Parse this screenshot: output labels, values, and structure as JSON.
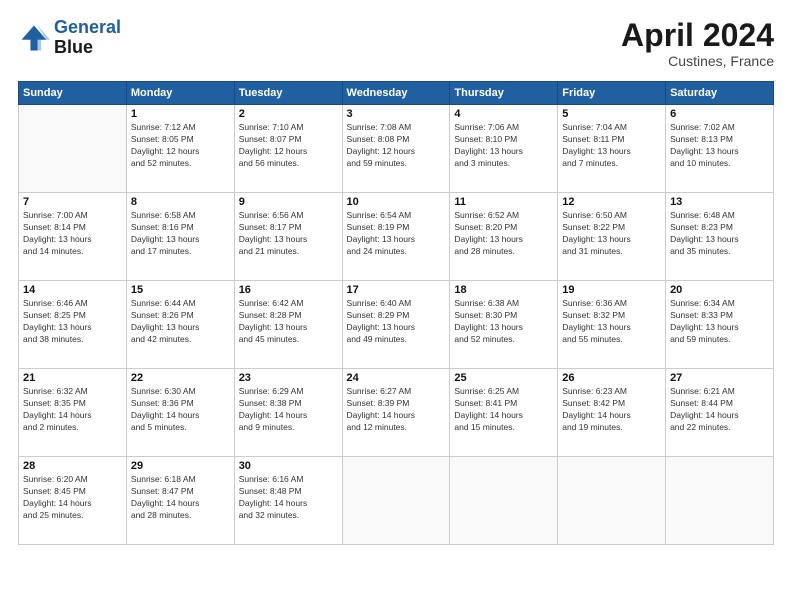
{
  "header": {
    "logo_line1": "General",
    "logo_line2": "Blue",
    "month_year": "April 2024",
    "location": "Custines, France"
  },
  "weekdays": [
    "Sunday",
    "Monday",
    "Tuesday",
    "Wednesday",
    "Thursday",
    "Friday",
    "Saturday"
  ],
  "weeks": [
    [
      {
        "day": "",
        "info": ""
      },
      {
        "day": "1",
        "info": "Sunrise: 7:12 AM\nSunset: 8:05 PM\nDaylight: 12 hours\nand 52 minutes."
      },
      {
        "day": "2",
        "info": "Sunrise: 7:10 AM\nSunset: 8:07 PM\nDaylight: 12 hours\nand 56 minutes."
      },
      {
        "day": "3",
        "info": "Sunrise: 7:08 AM\nSunset: 8:08 PM\nDaylight: 12 hours\nand 59 minutes."
      },
      {
        "day": "4",
        "info": "Sunrise: 7:06 AM\nSunset: 8:10 PM\nDaylight: 13 hours\nand 3 minutes."
      },
      {
        "day": "5",
        "info": "Sunrise: 7:04 AM\nSunset: 8:11 PM\nDaylight: 13 hours\nand 7 minutes."
      },
      {
        "day": "6",
        "info": "Sunrise: 7:02 AM\nSunset: 8:13 PM\nDaylight: 13 hours\nand 10 minutes."
      }
    ],
    [
      {
        "day": "7",
        "info": "Sunrise: 7:00 AM\nSunset: 8:14 PM\nDaylight: 13 hours\nand 14 minutes."
      },
      {
        "day": "8",
        "info": "Sunrise: 6:58 AM\nSunset: 8:16 PM\nDaylight: 13 hours\nand 17 minutes."
      },
      {
        "day": "9",
        "info": "Sunrise: 6:56 AM\nSunset: 8:17 PM\nDaylight: 13 hours\nand 21 minutes."
      },
      {
        "day": "10",
        "info": "Sunrise: 6:54 AM\nSunset: 8:19 PM\nDaylight: 13 hours\nand 24 minutes."
      },
      {
        "day": "11",
        "info": "Sunrise: 6:52 AM\nSunset: 8:20 PM\nDaylight: 13 hours\nand 28 minutes."
      },
      {
        "day": "12",
        "info": "Sunrise: 6:50 AM\nSunset: 8:22 PM\nDaylight: 13 hours\nand 31 minutes."
      },
      {
        "day": "13",
        "info": "Sunrise: 6:48 AM\nSunset: 8:23 PM\nDaylight: 13 hours\nand 35 minutes."
      }
    ],
    [
      {
        "day": "14",
        "info": "Sunrise: 6:46 AM\nSunset: 8:25 PM\nDaylight: 13 hours\nand 38 minutes."
      },
      {
        "day": "15",
        "info": "Sunrise: 6:44 AM\nSunset: 8:26 PM\nDaylight: 13 hours\nand 42 minutes."
      },
      {
        "day": "16",
        "info": "Sunrise: 6:42 AM\nSunset: 8:28 PM\nDaylight: 13 hours\nand 45 minutes."
      },
      {
        "day": "17",
        "info": "Sunrise: 6:40 AM\nSunset: 8:29 PM\nDaylight: 13 hours\nand 49 minutes."
      },
      {
        "day": "18",
        "info": "Sunrise: 6:38 AM\nSunset: 8:30 PM\nDaylight: 13 hours\nand 52 minutes."
      },
      {
        "day": "19",
        "info": "Sunrise: 6:36 AM\nSunset: 8:32 PM\nDaylight: 13 hours\nand 55 minutes."
      },
      {
        "day": "20",
        "info": "Sunrise: 6:34 AM\nSunset: 8:33 PM\nDaylight: 13 hours\nand 59 minutes."
      }
    ],
    [
      {
        "day": "21",
        "info": "Sunrise: 6:32 AM\nSunset: 8:35 PM\nDaylight: 14 hours\nand 2 minutes."
      },
      {
        "day": "22",
        "info": "Sunrise: 6:30 AM\nSunset: 8:36 PM\nDaylight: 14 hours\nand 5 minutes."
      },
      {
        "day": "23",
        "info": "Sunrise: 6:29 AM\nSunset: 8:38 PM\nDaylight: 14 hours\nand 9 minutes."
      },
      {
        "day": "24",
        "info": "Sunrise: 6:27 AM\nSunset: 8:39 PM\nDaylight: 14 hours\nand 12 minutes."
      },
      {
        "day": "25",
        "info": "Sunrise: 6:25 AM\nSunset: 8:41 PM\nDaylight: 14 hours\nand 15 minutes."
      },
      {
        "day": "26",
        "info": "Sunrise: 6:23 AM\nSunset: 8:42 PM\nDaylight: 14 hours\nand 19 minutes."
      },
      {
        "day": "27",
        "info": "Sunrise: 6:21 AM\nSunset: 8:44 PM\nDaylight: 14 hours\nand 22 minutes."
      }
    ],
    [
      {
        "day": "28",
        "info": "Sunrise: 6:20 AM\nSunset: 8:45 PM\nDaylight: 14 hours\nand 25 minutes."
      },
      {
        "day": "29",
        "info": "Sunrise: 6:18 AM\nSunset: 8:47 PM\nDaylight: 14 hours\nand 28 minutes."
      },
      {
        "day": "30",
        "info": "Sunrise: 6:16 AM\nSunset: 8:48 PM\nDaylight: 14 hours\nand 32 minutes."
      },
      {
        "day": "",
        "info": ""
      },
      {
        "day": "",
        "info": ""
      },
      {
        "day": "",
        "info": ""
      },
      {
        "day": "",
        "info": ""
      }
    ]
  ]
}
